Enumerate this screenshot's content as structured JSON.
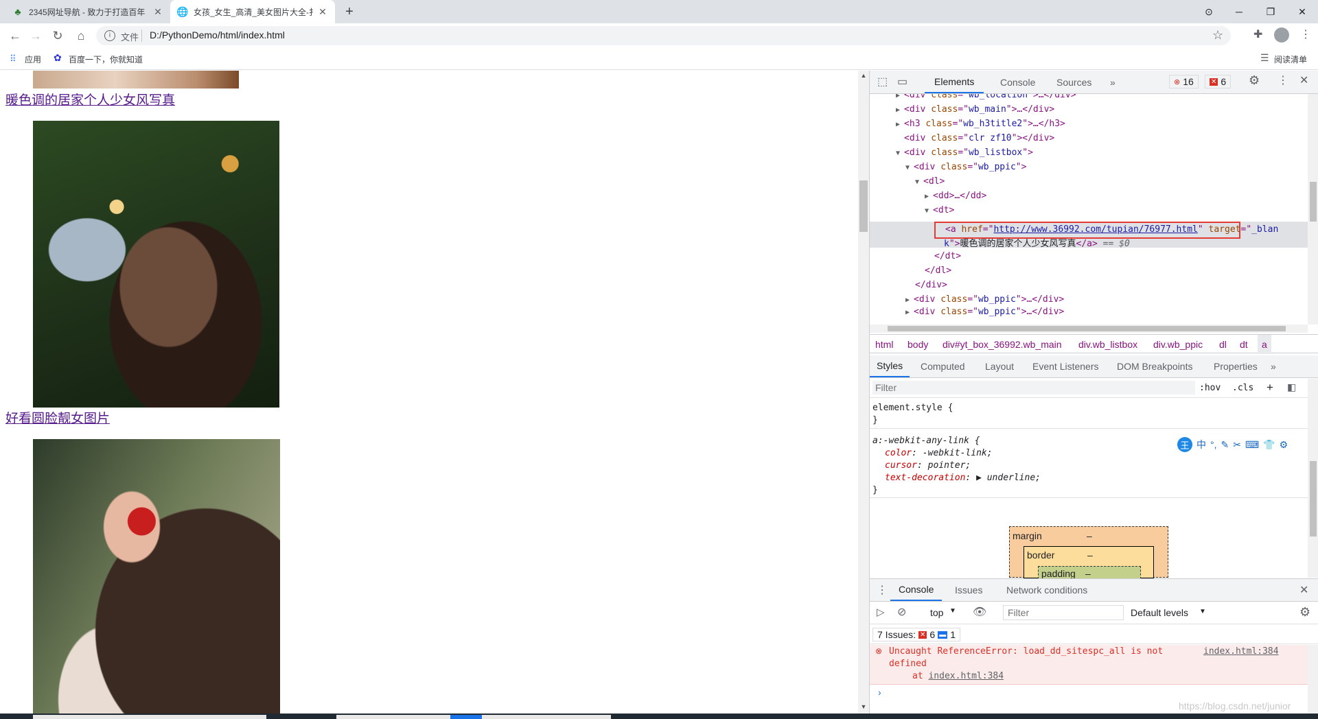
{
  "tabs": [
    {
      "title": "2345网址导航 - 致力于打造百年",
      "icon": "2345-logo-icon",
      "active": false
    },
    {
      "title": "女孩_女生_高清_美女图片大全-扌",
      "icon": "globe-icon",
      "active": true
    }
  ],
  "toolbar": {
    "scheme_label": "文件",
    "url": "D:/PythonDemo/html/index.html"
  },
  "bookmarks": {
    "apps_label": "应用",
    "baidu_label": "百度一下，你就知道",
    "reading_list_label": "阅读清单"
  },
  "page": {
    "links": [
      "暖色调的居家个人少女风写真",
      "好看圆脸靓女图片"
    ]
  },
  "devtools": {
    "tabs": [
      "Elements",
      "Console",
      "Sources"
    ],
    "error_count": "16",
    "warning_count": "6",
    "dom_lines": [
      {
        "indent": 0,
        "tri": "▶",
        "tag": "div",
        "attr": "class",
        "val": "wb_location",
        "tail": ">…</div>"
      },
      {
        "indent": 0,
        "tri": "▶",
        "tag": "div",
        "attr": "class",
        "val": "wb_main",
        "tail": ">…</div>"
      },
      {
        "indent": 0,
        "tri": "▶",
        "tag": "h3",
        "attr": "class",
        "val": "wb_h3title2",
        "tail": ">…</h3>"
      },
      {
        "indent": 0,
        "tri": "",
        "tag": "div",
        "attr": "class",
        "val": "clr zf10",
        "tail": "></div>"
      },
      {
        "indent": 0,
        "tri": "▼",
        "tag": "div",
        "attr": "class",
        "val": "wb_listbox",
        "tail": ">"
      },
      {
        "indent": 1,
        "tri": "▼",
        "tag": "div",
        "attr": "class",
        "val": "wb_ppic",
        "tail": ">"
      },
      {
        "indent": 2,
        "tri": "▼",
        "tag": "dl",
        "attr": "",
        "val": "",
        "tail": ">"
      },
      {
        "indent": 3,
        "tri": "▶",
        "tag": "dd",
        "attr": "",
        "val": "",
        "tail": ">…</dd>"
      },
      {
        "indent": 3,
        "tri": "▼",
        "tag": "dt",
        "attr": "",
        "val": "",
        "tail": ">"
      }
    ],
    "selected_href": "http://www.36992.com/tupian/76977.html",
    "selected_target_a": "_blan",
    "selected_target_b": "k",
    "selected_text": "暖色调的居家个人少女风写真",
    "selected_suffix": "== $0",
    "close_dt": "</dt>",
    "close_dl": "</dl>",
    "close_div": "</div>",
    "after_lines": [
      {
        "tri": "▶",
        "tag": "div",
        "attr": "class",
        "val": "wb_ppic",
        "tail": ">…</div>"
      },
      {
        "tri": "▶",
        "tag": "div",
        "attr": "class",
        "val": "wb_ppic",
        "tail": ">…</div>"
      }
    ],
    "breadcrumbs": [
      "html",
      "body",
      "div#yt_box_36992.wb_main",
      "div.wb_listbox",
      "div.wb_ppic",
      "dl",
      "dt",
      "a"
    ],
    "style_tabs": [
      "Styles",
      "Computed",
      "Layout",
      "Event Listeners",
      "DOM Breakpoints",
      "Properties"
    ],
    "filter_placeholder": "Filter",
    "hov": ":hov",
    "cls": ".cls",
    "element_style": "element.style {",
    "close_brace": "}",
    "rule_selector": "a:-webkit-any-link {",
    "rule_props": [
      {
        "name": "color",
        "value": "-webkit-link;"
      },
      {
        "name": "cursor",
        "value": "pointer;"
      },
      {
        "name": "text-decoration",
        "value": "▶ underline;"
      }
    ],
    "boxmodel": {
      "margin": "margin",
      "border": "border",
      "padding": "padding",
      "dash": "–"
    },
    "drawer_tabs": [
      "Console",
      "Issues",
      "Network conditions"
    ],
    "context": "top",
    "console_filter": "Filter",
    "default_levels": "Default levels",
    "issues_label": "7 Issues:",
    "issues_errors": "6",
    "issues_info": "1",
    "error_line1": "Uncaught ReferenceError: load_dd_sitespc_all is not",
    "error_line2": "defined",
    "error_line3_prefix": "at",
    "error_source": "index.html:384",
    "watermark": "https://blog.csdn.net/junior"
  },
  "colors": {
    "accent": "#1a73e8",
    "error": "#d93025",
    "highlight_border": "#e53935"
  }
}
